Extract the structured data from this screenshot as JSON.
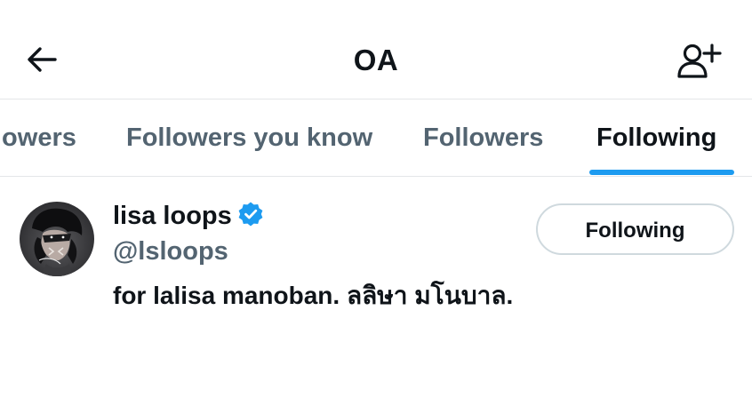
{
  "header": {
    "title": "OA",
    "back_icon": "arrow-left-icon",
    "add_icon": "add-user-icon"
  },
  "tabs": [
    {
      "label": "Verified Followers",
      "visible_text": "lowers"
    },
    {
      "label": "Followers you know"
    },
    {
      "label": "Followers"
    },
    {
      "label": "Following",
      "active": true
    }
  ],
  "user": {
    "display_name": "lisa loops",
    "handle": "@lsloops",
    "bio": "for lalisa manoban. ลลิษา มโนบาล.",
    "verified": true,
    "follow_button_label": "Following"
  },
  "colors": {
    "accent": "#1d9bf0",
    "text_primary": "#0f1419",
    "text_secondary": "#536471",
    "border": "#cfd9de"
  }
}
